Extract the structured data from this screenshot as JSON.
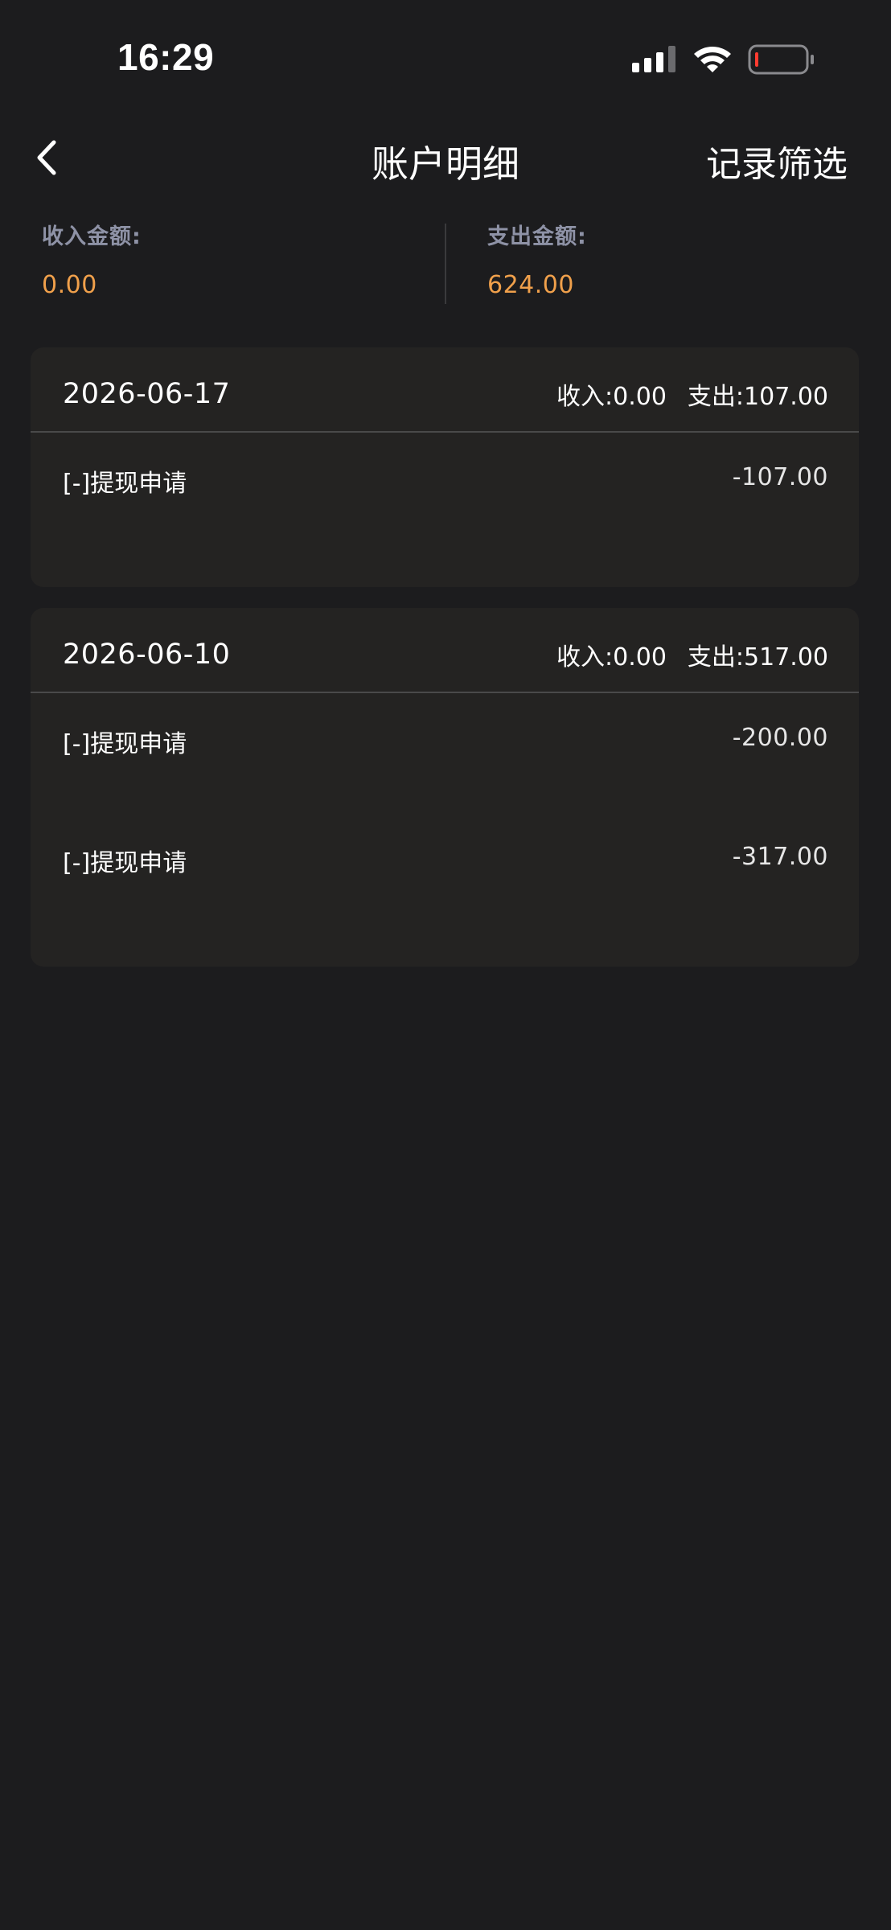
{
  "status_bar": {
    "time": "16:29",
    "icons": [
      "signal-icon",
      "wifi-icon",
      "battery-low-icon"
    ],
    "battery_level": 0.05
  },
  "nav": {
    "back_icon": "chevron-left-icon",
    "title": "账户明细",
    "filter_label": "记录筛选"
  },
  "summary": {
    "income_label": "收入金额:",
    "income_value": "0.00",
    "expense_label": "支出金额:",
    "expense_value": "624.00"
  },
  "groups": [
    {
      "date": "2026-06-17",
      "income_text": "收入:0.00",
      "expense_text": "支出:107.00",
      "records": [
        {
          "title": "[-]提现申请",
          "amount": "-107.00"
        }
      ]
    },
    {
      "date": "2026-06-10",
      "income_text": "收入:0.00",
      "expense_text": "支出:517.00",
      "records": [
        {
          "title": "[-]提现申请",
          "amount": "-200.00"
        },
        {
          "title": "[-]提现申请",
          "amount": "-317.00"
        }
      ]
    }
  ],
  "colors": {
    "background": "#1c1c1e",
    "card": "#242322",
    "accent_amount": "#f0a04b",
    "summary_label": "#8e92a6",
    "battery_low": "#ff3b30"
  }
}
